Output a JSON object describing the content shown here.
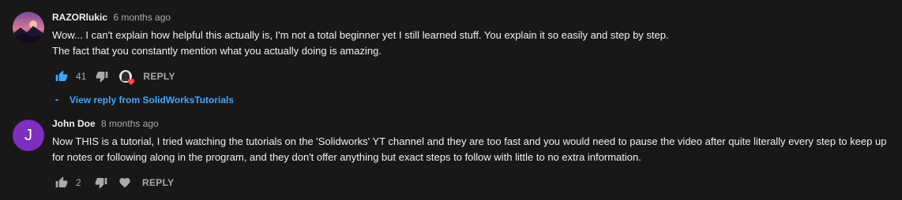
{
  "comments": [
    {
      "author": "RAZORlukic",
      "time": "6 months ago",
      "lines": [
        "Wow... I can't explain how helpful this actually is, I'm not a total beginner yet I still learned stuff. You explain it so easily and step by step.",
        "The fact that you constantly mention what you actually doing is amazing."
      ],
      "likes": "41",
      "liked": true,
      "creator_hearted": true,
      "reply_label": "REPLY",
      "view_replies_label": "View reply from SolidWorksTutorials",
      "avatar_icon": "landscape-avatar"
    },
    {
      "author": "John Doe",
      "time": "8 months ago",
      "avatar_letter": "J",
      "avatar_color": "#7e2fc0",
      "lines": [
        "Now THIS is a tutorial, I tried watching the tutorials on the 'Solidworks' YT channel and they are too fast and you would need to pause the video after quite literally every step to keep up for notes or following along in the program, and they don't offer anything but exact steps to follow with little to no extra information."
      ],
      "likes": "2",
      "liked": false,
      "reply_label": "REPLY"
    }
  ],
  "colors": {
    "background": "#181818",
    "like_active": "#3ea6ff",
    "icon_muted": "#aaaaaa",
    "link": "#3ea6ff",
    "heart": "#ff4e45"
  }
}
